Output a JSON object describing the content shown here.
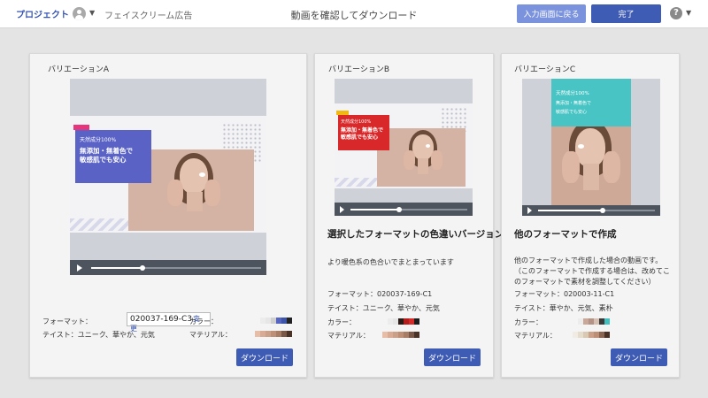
{
  "header": {
    "project_link": "プロジェクト",
    "project_name": "フェイスクリーム広告",
    "page_title": "動画を確認してダウンロード",
    "back_button": "入力画面に戻る",
    "done_button": "完了",
    "help_icon_glyph": "?",
    "accent_color": "#3f5cb5"
  },
  "variations": [
    {
      "title": "バリエーションA",
      "overlay_small": "天然成分100%",
      "overlay_line1": "無添加・無着色で",
      "overlay_line2": "敏感肌でも安心",
      "video_progress": 0.3,
      "format_label": "フォーマット：",
      "format_value": "020037-169-C3",
      "change_link": "変更",
      "taste": "テイスト：ユニーク、華やか、元気",
      "color_label": "カラー：",
      "material_label": "マテリアル：",
      "colors": [
        "#f4f4f4",
        "#ececec",
        "#e6e6e6",
        "#d0d0d0",
        "#5665bf",
        "#3c55a8",
        "#222222"
      ],
      "materials": [
        "#e6bea8",
        "#d9ab94",
        "#caa088",
        "#bd8f76",
        "#a87d66",
        "#7a5848",
        "#4a3226"
      ],
      "download": "ダウンロード"
    },
    {
      "title": "バリエーションB",
      "overlay_small": "天然成分100%",
      "overlay_line1": "無添加・無着色で",
      "overlay_line2": "敏感肌でも安心",
      "video_progress": 0.42,
      "headline": "選択したフォーマットの色違いバージョン",
      "subtext": "より暖色系の色合いでまとまっています",
      "format": "フォーマット：020037-169-C1",
      "taste": "テイスト：ユニーク、華やか、元気",
      "color_label": "カラー：",
      "material_label": "マテリアル：",
      "colors": [
        "#f4f4f4",
        "#ececec",
        "#e6e6e6",
        "#2a1a16",
        "#b51c1c",
        "#d42a2a",
        "#1c1c1c"
      ],
      "materials": [
        "#e6bea8",
        "#d9ab94",
        "#caa088",
        "#bd8f76",
        "#a87d66",
        "#7a5848",
        "#4a3226"
      ],
      "download": "ダウンロード"
    },
    {
      "title": "バリエーションC",
      "overlay_small": "天然成分100%",
      "overlay_line2": "無添加・無着色で",
      "overlay_line3": "敏感肌でも安心",
      "video_progress": 0.55,
      "headline": "他のフォーマットで作成",
      "desc_line1": "他のフォーマットで作成した場合の動画です。",
      "desc_line2": "（このフォーマットで作成する場合は、改めてこ",
      "desc_line3": "のフォーマットで素材を調整してください）",
      "format": "フォーマット：020003-11-C1",
      "taste": "テイスト：華やか、元気、素朴",
      "color_label": "カラー：",
      "material_label": "マテリアル：",
      "colors": [
        "#f4f4f4",
        "#ececec",
        "#c9a89a",
        "#b39385",
        "#d6c0b4",
        "#3a3a3a",
        "#41c0bf"
      ],
      "materials": [
        "#f1ece3",
        "#e6dccd",
        "#d9c8b2",
        "#caa088",
        "#bd8f76",
        "#8a6552",
        "#4a3226"
      ],
      "download": "ダウンロード"
    }
  ]
}
